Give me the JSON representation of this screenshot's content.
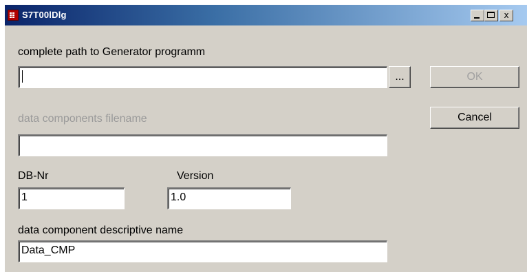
{
  "window": {
    "title": "S7T00lDlg",
    "minimize_label": "_",
    "maximize_label": "□",
    "close_label": "x"
  },
  "generator": {
    "label": "complete path to Generator programm",
    "value": "",
    "browse_label": "..."
  },
  "data_components": {
    "label": "data components filename",
    "value": ""
  },
  "db_nr": {
    "label": "DB-Nr",
    "value": "1"
  },
  "version": {
    "label": "Version",
    "value": "1.0"
  },
  "descriptive_name": {
    "label": "data component descriptive name",
    "value": "Data_CMP"
  },
  "buttons": {
    "ok": "OK",
    "cancel": "Cancel"
  }
}
